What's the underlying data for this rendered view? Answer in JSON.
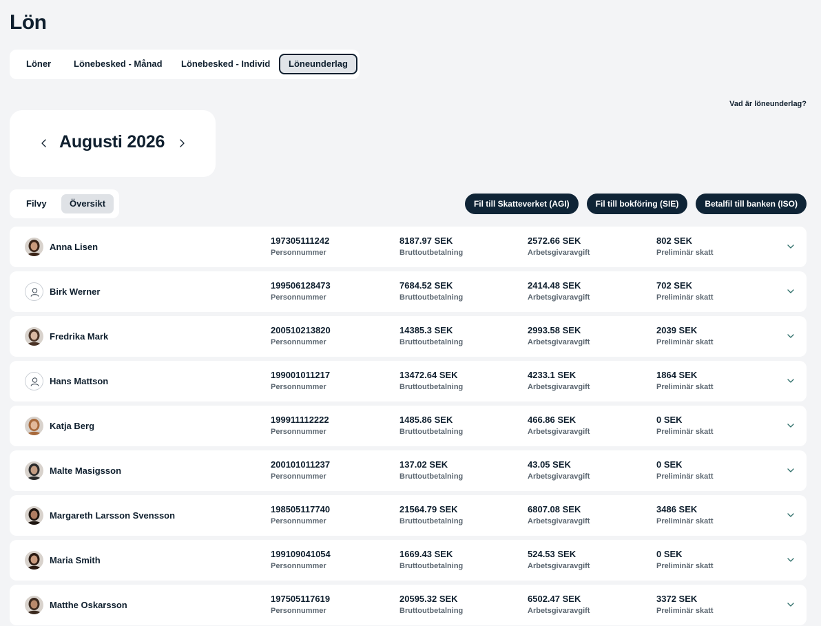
{
  "page_title": "Lön",
  "tabs": [
    {
      "label": "Löner",
      "active": false
    },
    {
      "label": "Lönebesked - Månad",
      "active": false
    },
    {
      "label": "Lönebesked - Individ",
      "active": false
    },
    {
      "label": "Löneunderlag",
      "active": true
    }
  ],
  "help_link": "Vad är löneunderlag?",
  "month": {
    "label": "Augusti 2026",
    "prev_icon": "chevron-left-icon",
    "next_icon": "chevron-right-icon"
  },
  "view_toggle": [
    {
      "label": "Filvy",
      "active": false
    },
    {
      "label": "Översikt",
      "active": true
    }
  ],
  "exports": [
    {
      "label": "Fil till Skatteverket (AGI)"
    },
    {
      "label": "Fil till bokföring (SIE)"
    },
    {
      "label": "Betalfil till banken (ISO)"
    }
  ],
  "column_labels": {
    "personnummer": "Personnummer",
    "brutto": "Bruttoutbetalning",
    "arbetsgivaravgift": "Arbetsgivaravgift",
    "skatt": "Preliminär skatt"
  },
  "colors": {
    "accent_dark": "#0f2436",
    "chevron": "#2f6f6a",
    "background": "#f3f4f6"
  },
  "employees": [
    {
      "name": "Anna Lisen",
      "personnummer": "197305111242",
      "brutto": "8187.97 SEK",
      "arbetsgivaravgift": "2572.66 SEK",
      "skatt": "802 SEK",
      "avatar": "photo",
      "skin": "#c99a7c",
      "hair": "#3a2418"
    },
    {
      "name": "Birk Werner",
      "personnummer": "199506128473",
      "brutto": "7684.52 SEK",
      "arbetsgivaravgift": "2414.48 SEK",
      "skatt": "702 SEK",
      "avatar": "placeholder",
      "skin": "",
      "hair": ""
    },
    {
      "name": "Fredrika Mark",
      "personnummer": "200510213820",
      "brutto": "14385.3 SEK",
      "arbetsgivaravgift": "2993.58 SEK",
      "skatt": "2039 SEK",
      "avatar": "photo",
      "skin": "#d9b8a2",
      "hair": "#4a3326"
    },
    {
      "name": "Hans Mattson",
      "personnummer": "199001011217",
      "brutto": "13472.64 SEK",
      "arbetsgivaravgift": "4233.1 SEK",
      "skatt": "1864 SEK",
      "avatar": "placeholder",
      "skin": "",
      "hair": ""
    },
    {
      "name": "Katja Berg",
      "personnummer": "199911112222",
      "brutto": "1485.86 SEK",
      "arbetsgivaravgift": "466.86 SEK",
      "skatt": "0 SEK",
      "avatar": "photo",
      "skin": "#e2b99a",
      "hair": "#a86a3c"
    },
    {
      "name": "Malte Masigsson",
      "personnummer": "200101011237",
      "brutto": "137.02 SEK",
      "arbetsgivaravgift": "43.05 SEK",
      "skatt": "0 SEK",
      "avatar": "photo",
      "skin": "#c49d83",
      "hair": "#2b2b2b"
    },
    {
      "name": "Margareth Larsson Svensson",
      "personnummer": "198505117740",
      "brutto": "21564.79 SEK",
      "arbetsgivaravgift": "6807.08 SEK",
      "skatt": "3486 SEK",
      "avatar": "photo",
      "skin": "#b07d62",
      "hair": "#1e1510"
    },
    {
      "name": "Maria Smith",
      "personnummer": "199109041054",
      "brutto": "1669.43 SEK",
      "arbetsgivaravgift": "524.53 SEK",
      "skatt": "0 SEK",
      "avatar": "photo",
      "skin": "#c89a7e",
      "hair": "#2a1a12"
    },
    {
      "name": "Matthe Oskarsson",
      "personnummer": "197505117619",
      "brutto": "20595.32 SEK",
      "arbetsgivaravgift": "6502.47 SEK",
      "skatt": "3372 SEK",
      "avatar": "photo",
      "skin": "#b98a6c",
      "hair": "#3b2a1f"
    }
  ]
}
